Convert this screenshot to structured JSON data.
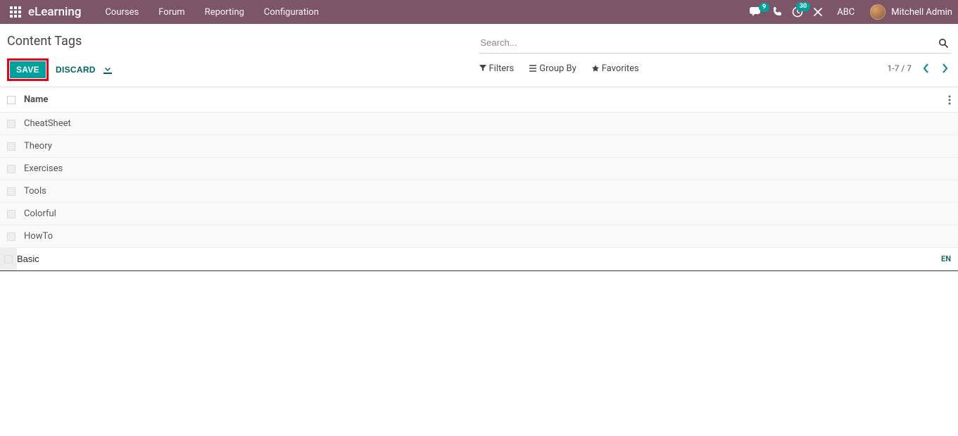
{
  "topbar": {
    "brand": "eLearning",
    "nav": [
      "Courses",
      "Forum",
      "Reporting",
      "Configuration"
    ],
    "chat_badge": "9",
    "clock_badge": "30",
    "abc": "ABC",
    "user": "Mitchell Admin"
  },
  "page": {
    "title": "Content Tags",
    "save": "SAVE",
    "discard": "DISCARD"
  },
  "search": {
    "placeholder": "Search...",
    "filters": [
      "Filters",
      "Group By",
      "Favorites"
    ],
    "pager": "1-7 / 7"
  },
  "table": {
    "col_name": "Name",
    "rows": [
      "CheatSheet",
      "Theory",
      "Exercises",
      "Tools",
      "Colorful",
      "HowTo"
    ],
    "editing_value": "Basic",
    "lang": "EN"
  }
}
